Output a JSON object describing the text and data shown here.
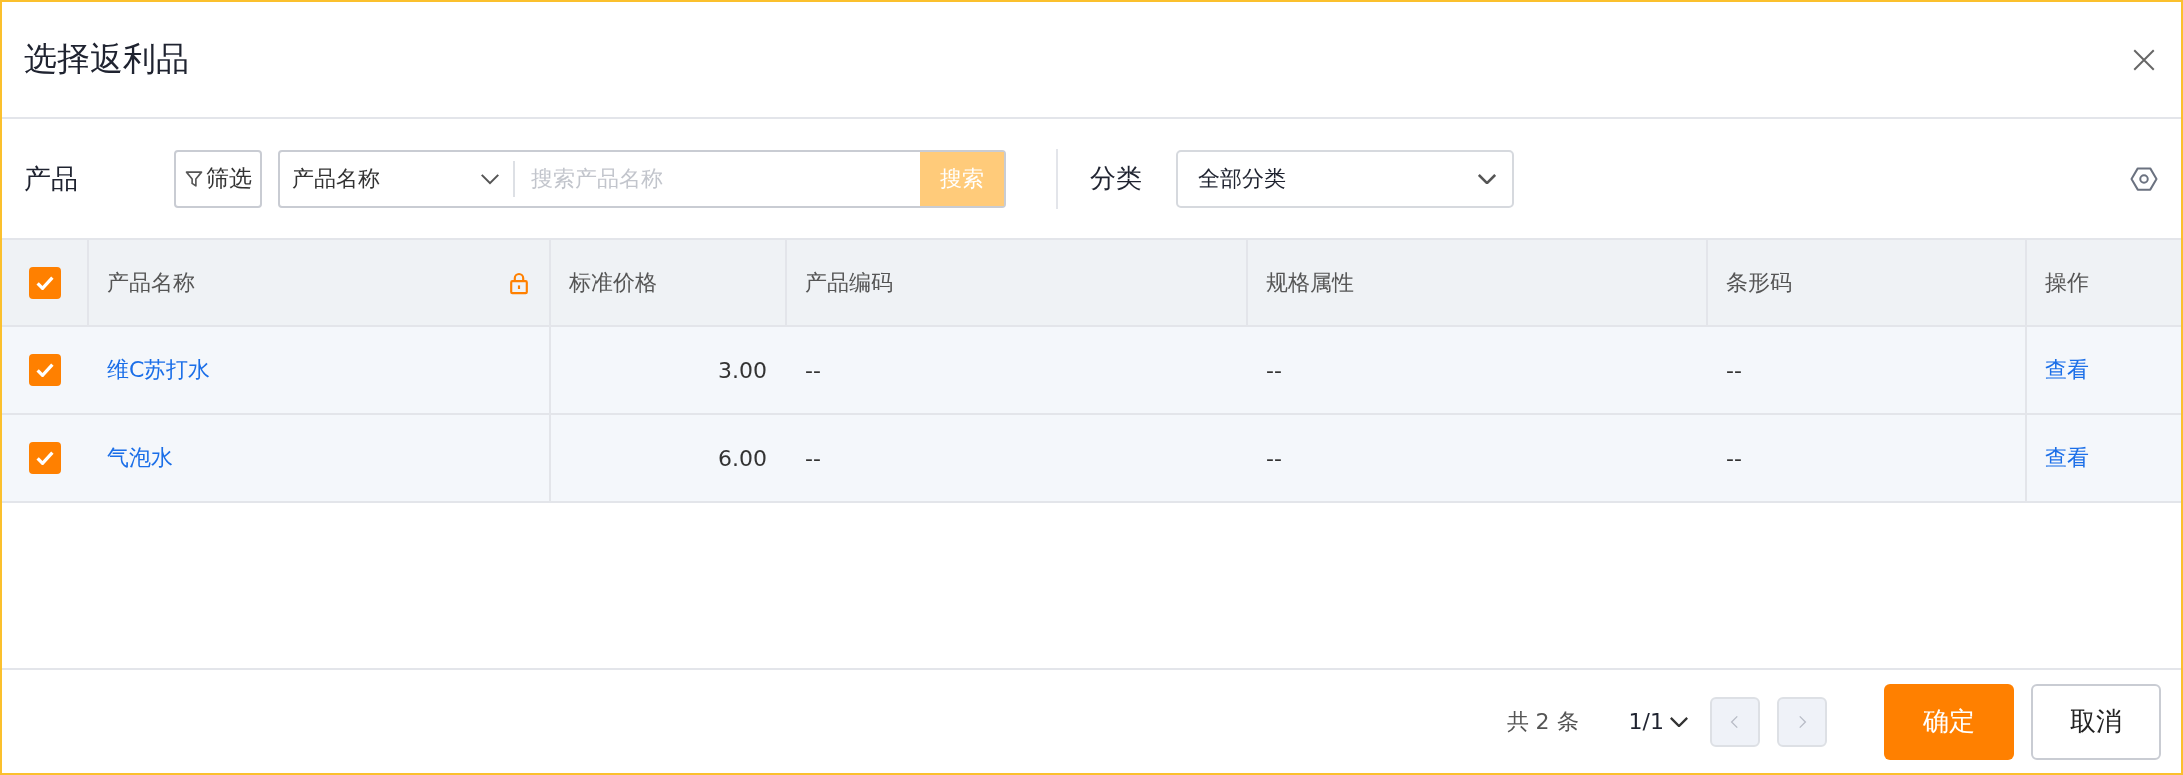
{
  "dialog": {
    "title": "选择返利品"
  },
  "toolbar": {
    "label": "产品",
    "filter_button": "筛选",
    "search_field": {
      "value": "产品名称",
      "placeholder": "搜索产品名称"
    },
    "search_button": "搜索",
    "category_label": "分类",
    "category_select": "全部分类"
  },
  "table": {
    "select_all": {
      "checked": true
    },
    "columns": [
      "产品名称",
      "标准价格",
      "产品编码",
      "规格属性",
      "条形码",
      "操作"
    ],
    "rows": [
      {
        "checked": true,
        "name": "维C苏打水",
        "price": "3.00",
        "code": "--",
        "spec": "--",
        "barcode": "--",
        "action": "查看"
      },
      {
        "checked": true,
        "name": "气泡水",
        "price": "6.00",
        "code": "--",
        "spec": "--",
        "barcode": "--",
        "action": "查看"
      }
    ]
  },
  "footer": {
    "total": "共 2 条",
    "page": "1/1",
    "prev_disabled": true,
    "next_disabled": true,
    "buttons": [
      "确定",
      "取消"
    ]
  }
}
